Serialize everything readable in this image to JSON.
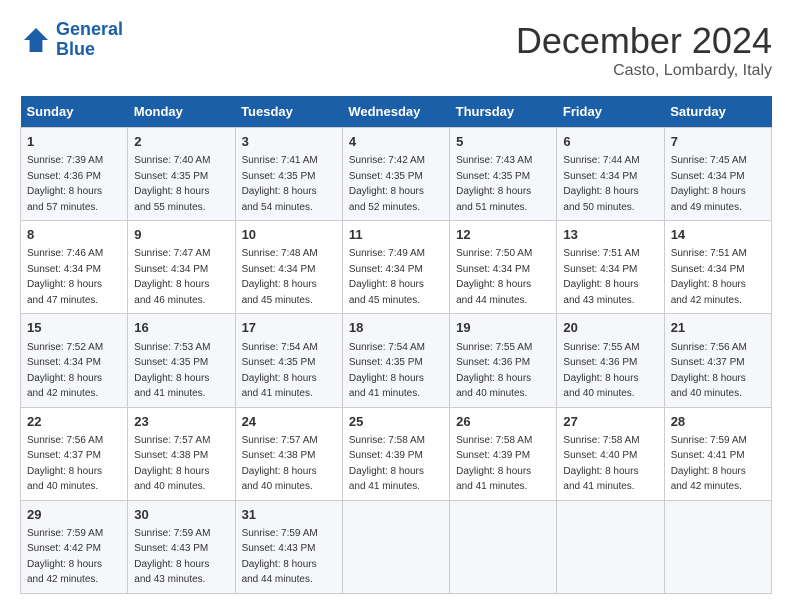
{
  "header": {
    "logo_line1": "General",
    "logo_line2": "Blue",
    "month": "December 2024",
    "location": "Casto, Lombardy, Italy"
  },
  "weekdays": [
    "Sunday",
    "Monday",
    "Tuesday",
    "Wednesday",
    "Thursday",
    "Friday",
    "Saturday"
  ],
  "weeks": [
    [
      {
        "day": "1",
        "sunrise": "7:39 AM",
        "sunset": "4:36 PM",
        "daylight": "8 hours and 57 minutes."
      },
      {
        "day": "2",
        "sunrise": "7:40 AM",
        "sunset": "4:35 PM",
        "daylight": "8 hours and 55 minutes."
      },
      {
        "day": "3",
        "sunrise": "7:41 AM",
        "sunset": "4:35 PM",
        "daylight": "8 hours and 54 minutes."
      },
      {
        "day": "4",
        "sunrise": "7:42 AM",
        "sunset": "4:35 PM",
        "daylight": "8 hours and 52 minutes."
      },
      {
        "day": "5",
        "sunrise": "7:43 AM",
        "sunset": "4:35 PM",
        "daylight": "8 hours and 51 minutes."
      },
      {
        "day": "6",
        "sunrise": "7:44 AM",
        "sunset": "4:34 PM",
        "daylight": "8 hours and 50 minutes."
      },
      {
        "day": "7",
        "sunrise": "7:45 AM",
        "sunset": "4:34 PM",
        "daylight": "8 hours and 49 minutes."
      }
    ],
    [
      {
        "day": "8",
        "sunrise": "7:46 AM",
        "sunset": "4:34 PM",
        "daylight": "8 hours and 47 minutes."
      },
      {
        "day": "9",
        "sunrise": "7:47 AM",
        "sunset": "4:34 PM",
        "daylight": "8 hours and 46 minutes."
      },
      {
        "day": "10",
        "sunrise": "7:48 AM",
        "sunset": "4:34 PM",
        "daylight": "8 hours and 45 minutes."
      },
      {
        "day": "11",
        "sunrise": "7:49 AM",
        "sunset": "4:34 PM",
        "daylight": "8 hours and 45 minutes."
      },
      {
        "day": "12",
        "sunrise": "7:50 AM",
        "sunset": "4:34 PM",
        "daylight": "8 hours and 44 minutes."
      },
      {
        "day": "13",
        "sunrise": "7:51 AM",
        "sunset": "4:34 PM",
        "daylight": "8 hours and 43 minutes."
      },
      {
        "day": "14",
        "sunrise": "7:51 AM",
        "sunset": "4:34 PM",
        "daylight": "8 hours and 42 minutes."
      }
    ],
    [
      {
        "day": "15",
        "sunrise": "7:52 AM",
        "sunset": "4:34 PM",
        "daylight": "8 hours and 42 minutes."
      },
      {
        "day": "16",
        "sunrise": "7:53 AM",
        "sunset": "4:35 PM",
        "daylight": "8 hours and 41 minutes."
      },
      {
        "day": "17",
        "sunrise": "7:54 AM",
        "sunset": "4:35 PM",
        "daylight": "8 hours and 41 minutes."
      },
      {
        "day": "18",
        "sunrise": "7:54 AM",
        "sunset": "4:35 PM",
        "daylight": "8 hours and 41 minutes."
      },
      {
        "day": "19",
        "sunrise": "7:55 AM",
        "sunset": "4:36 PM",
        "daylight": "8 hours and 40 minutes."
      },
      {
        "day": "20",
        "sunrise": "7:55 AM",
        "sunset": "4:36 PM",
        "daylight": "8 hours and 40 minutes."
      },
      {
        "day": "21",
        "sunrise": "7:56 AM",
        "sunset": "4:37 PM",
        "daylight": "8 hours and 40 minutes."
      }
    ],
    [
      {
        "day": "22",
        "sunrise": "7:56 AM",
        "sunset": "4:37 PM",
        "daylight": "8 hours and 40 minutes."
      },
      {
        "day": "23",
        "sunrise": "7:57 AM",
        "sunset": "4:38 PM",
        "daylight": "8 hours and 40 minutes."
      },
      {
        "day": "24",
        "sunrise": "7:57 AM",
        "sunset": "4:38 PM",
        "daylight": "8 hours and 40 minutes."
      },
      {
        "day": "25",
        "sunrise": "7:58 AM",
        "sunset": "4:39 PM",
        "daylight": "8 hours and 41 minutes."
      },
      {
        "day": "26",
        "sunrise": "7:58 AM",
        "sunset": "4:39 PM",
        "daylight": "8 hours and 41 minutes."
      },
      {
        "day": "27",
        "sunrise": "7:58 AM",
        "sunset": "4:40 PM",
        "daylight": "8 hours and 41 minutes."
      },
      {
        "day": "28",
        "sunrise": "7:59 AM",
        "sunset": "4:41 PM",
        "daylight": "8 hours and 42 minutes."
      }
    ],
    [
      {
        "day": "29",
        "sunrise": "7:59 AM",
        "sunset": "4:42 PM",
        "daylight": "8 hours and 42 minutes."
      },
      {
        "day": "30",
        "sunrise": "7:59 AM",
        "sunset": "4:43 PM",
        "daylight": "8 hours and 43 minutes."
      },
      {
        "day": "31",
        "sunrise": "7:59 AM",
        "sunset": "4:43 PM",
        "daylight": "8 hours and 44 minutes."
      },
      null,
      null,
      null,
      null
    ]
  ]
}
